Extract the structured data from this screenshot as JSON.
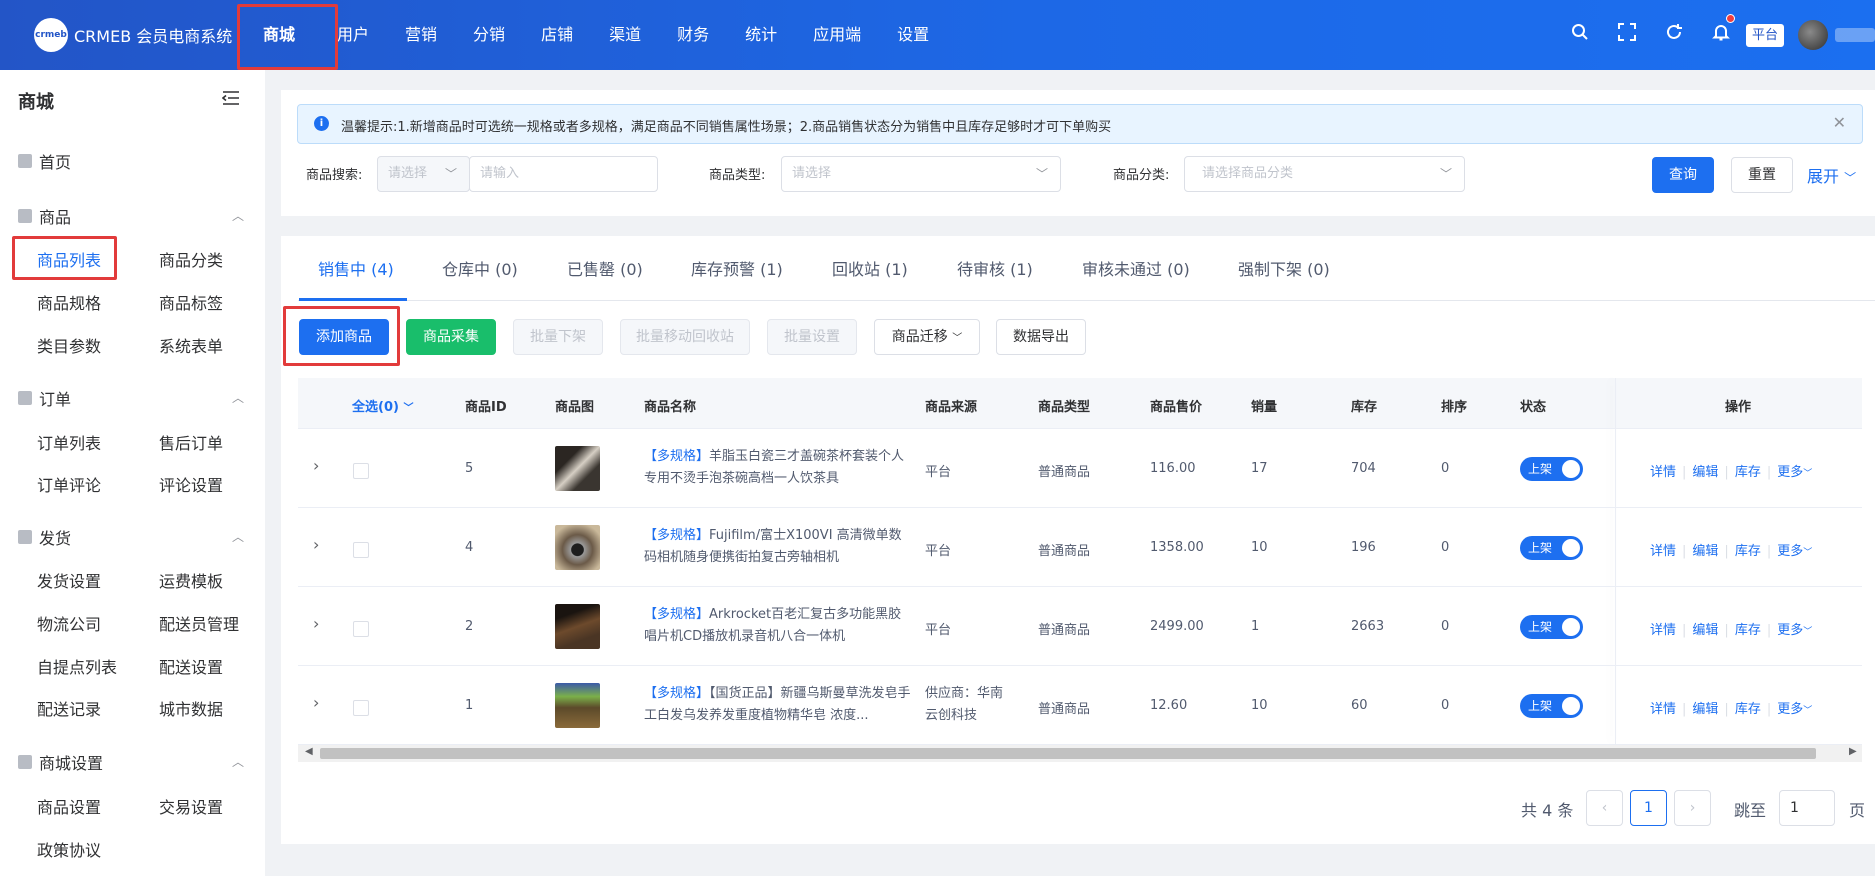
{
  "header": {
    "logo_mark": "crmeb",
    "logo_text": "CRMEB 会员电商系统",
    "nav": [
      "商城",
      "用户",
      "营销",
      "分销",
      "店铺",
      "渠道",
      "财务",
      "统计",
      "应用端",
      "设置"
    ],
    "platform_tag": "平台",
    "icons": [
      "search-icon",
      "fullscreen-icon",
      "refresh-icon",
      "bell-icon"
    ]
  },
  "sidebar": {
    "title": "商城",
    "home": "首页",
    "groups": [
      {
        "label": "商品",
        "items": [
          "商品列表",
          "商品分类",
          "商品规格",
          "商品标签",
          "类目参数",
          "系统表单"
        ]
      },
      {
        "label": "订单",
        "items": [
          "订单列表",
          "售后订单",
          "订单评论",
          "评论设置"
        ]
      },
      {
        "label": "发货",
        "items": [
          "发货设置",
          "运费模板",
          "物流公司",
          "配送员管理",
          "自提点列表",
          "配送设置",
          "配送记录",
          "城市数据"
        ]
      },
      {
        "label": "商城设置",
        "items": [
          "商品设置",
          "交易设置",
          "政策协议"
        ]
      }
    ]
  },
  "notice": {
    "text": "温馨提示:1.新增商品时可选统一规格或者多规格，满足商品不同销售属性场景；2.商品销售状态分为销售中且库存足够时才可下单购买"
  },
  "filters": {
    "search_label": "商品搜索:",
    "search_select_placeholder": "请选择",
    "search_input_placeholder": "请输入",
    "type_label": "商品类型:",
    "type_placeholder": "请选择",
    "category_label": "商品分类:",
    "category_placeholder": "请选择商品分类",
    "query": "查询",
    "reset": "重置",
    "expand": "展开"
  },
  "tabs": [
    "销售中 (4)",
    "仓库中 (0)",
    "已售罄 (0)",
    "库存预警 (1)",
    "回收站 (1)",
    "待审核 (1)",
    "审核未通过 (0)",
    "强制下架 (0)"
  ],
  "toolbar": {
    "add": "添加商品",
    "collect": "商品采集",
    "batch_off": "批量下架",
    "batch_recycle": "批量移动回收站",
    "batch_set": "批量设置",
    "migrate": "商品迁移",
    "export": "数据导出"
  },
  "table": {
    "headers": {
      "select_all": "全选(0)",
      "id": "商品ID",
      "image": "商品图",
      "name": "商品名称",
      "source": "商品来源",
      "type": "商品类型",
      "price": "商品售价",
      "sales": "销量",
      "stock": "库存",
      "sort": "排序",
      "status": "状态",
      "ops": "操作"
    },
    "rows": [
      {
        "id": "5",
        "tag": "【多规格】",
        "name": "羊脂玉白瓷三才盖碗茶杯套装个人专用不烫手泡茶碗高档一人饮茶具",
        "source": "平台",
        "type": "普通商品",
        "price": "116.00",
        "sales": "17",
        "stock": "704",
        "sort": "0",
        "status": "上架",
        "thumb_color": "#3a3530"
      },
      {
        "id": "4",
        "tag": "【多规格】",
        "name": "Fujifilm/富士X100VI 高清微单数码相机随身便携街拍复古旁轴相机",
        "source": "平台",
        "type": "普通商品",
        "price": "1358.00",
        "sales": "10",
        "stock": "196",
        "sort": "0",
        "status": "上架",
        "thumb_color": "#6b5a48"
      },
      {
        "id": "2",
        "tag": "【多规格】",
        "name": "Arkrocket百老汇复古多功能黑胶唱片机CD播放机录音机八合一体机",
        "source": "平台",
        "type": "普通商品",
        "price": "2499.00",
        "sales": "1",
        "stock": "2663",
        "sort": "0",
        "status": "上架",
        "thumb_color": "#4a3524"
      },
      {
        "id": "1",
        "tag": "【多规格】",
        "name": "【国货正品】新疆乌斯曼草洗发皂手工白发乌发养发重度植物精华皂 浓度...",
        "source": "供应商：华南云创科技",
        "type": "普通商品",
        "price": "12.60",
        "sales": "10",
        "stock": "60",
        "sort": "0",
        "status": "上架",
        "thumb_color": "#5c4a2a"
      }
    ],
    "ops": [
      "详情",
      "编辑",
      "库存",
      "更多"
    ]
  },
  "pager": {
    "total": "共 4 条",
    "current": "1",
    "jump_label": "跳至",
    "jump_value": "1",
    "page_unit": "页"
  },
  "colors": {
    "primary": "#1d6ff0",
    "success": "#19be6b",
    "highlight": "#e23b3b"
  }
}
